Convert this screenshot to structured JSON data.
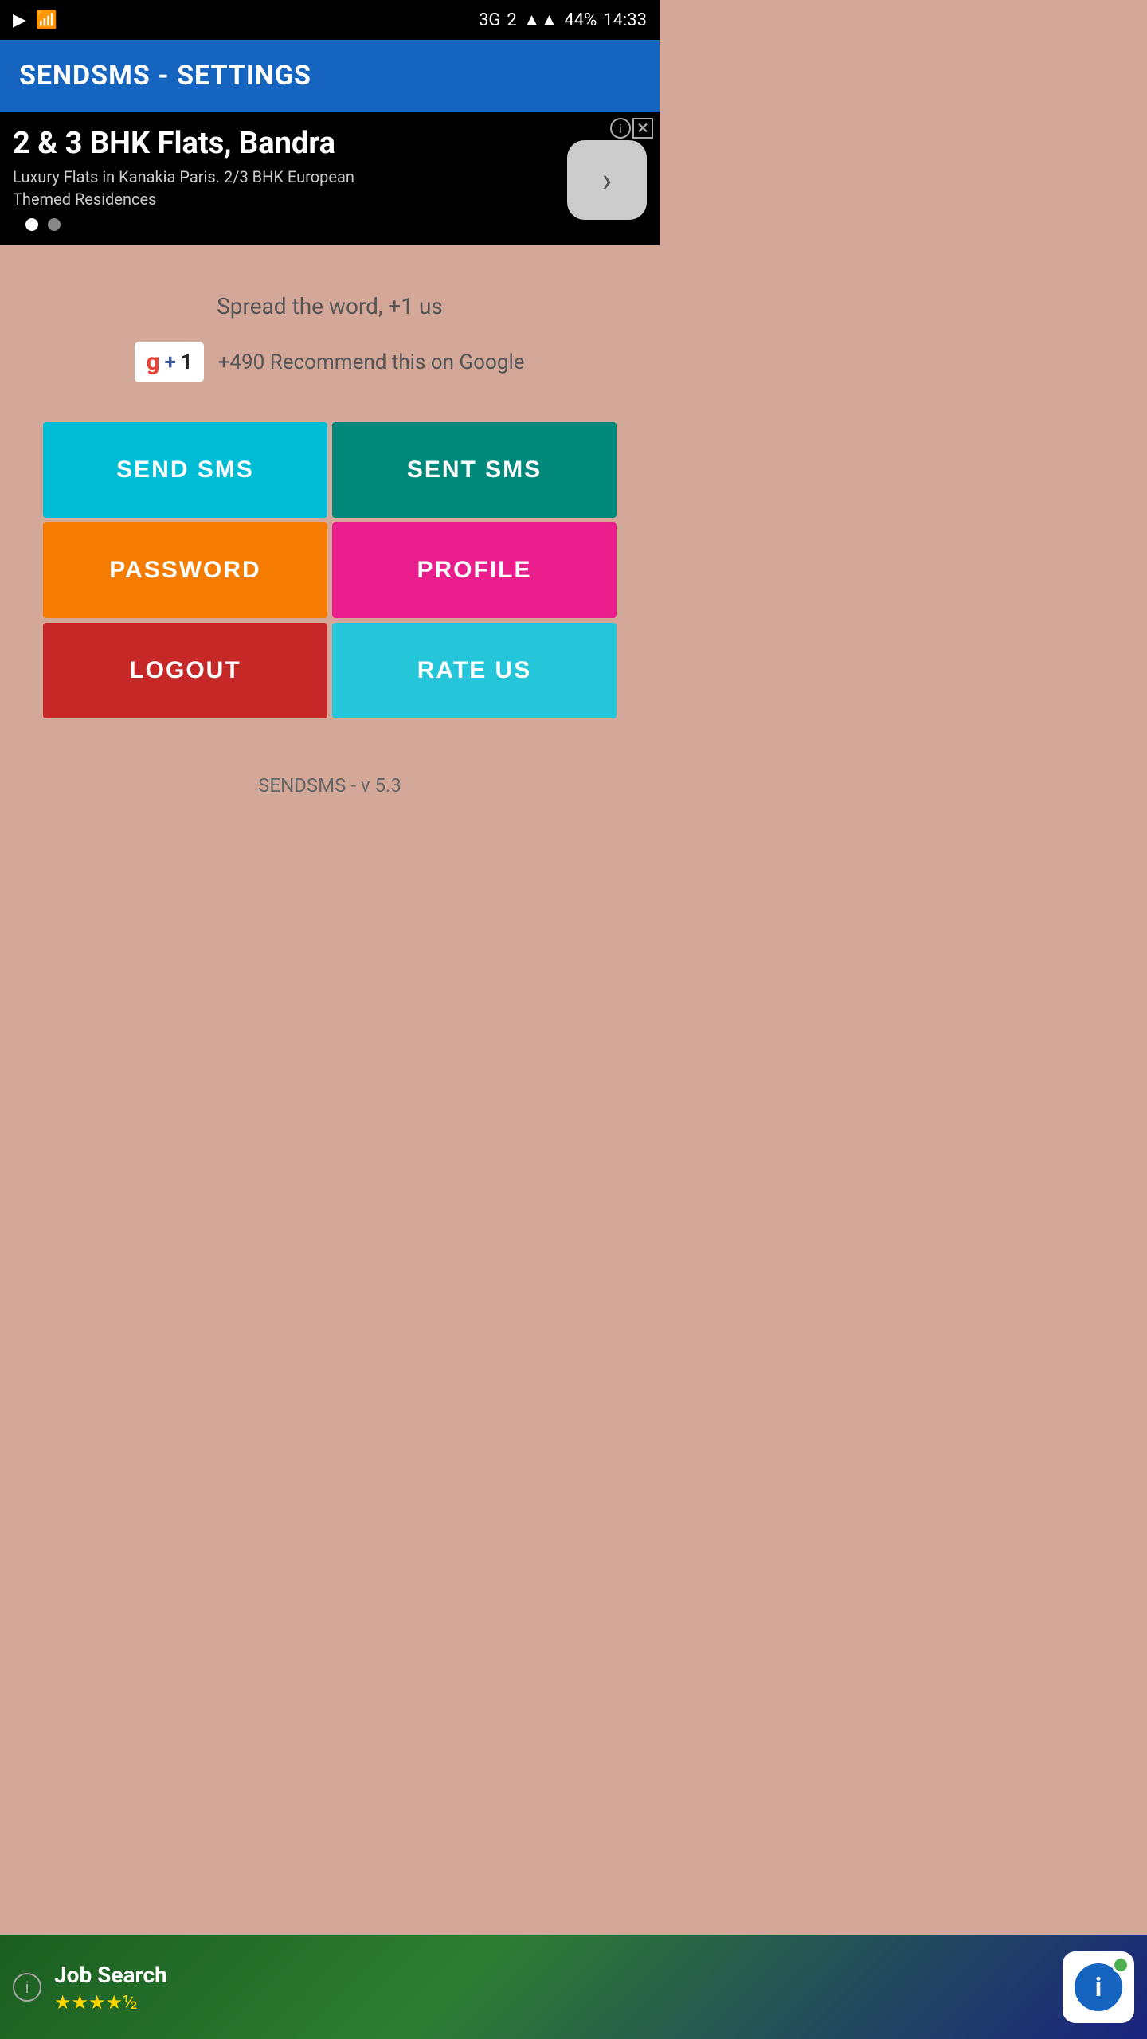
{
  "statusBar": {
    "time": "14:33",
    "battery": "44%",
    "network": "3G",
    "sim": "2"
  },
  "appBar": {
    "title": "SENDSMS - SETTINGS"
  },
  "ad": {
    "title": "2 & 3 BHK Flats, Bandra",
    "subtitle": "Luxury Flats in Kanakia Paris. 2/3 BHK European Themed Residences",
    "arrowLabel": "›",
    "closeBtnInfo": "ⓘ",
    "closeBtnX": "✕",
    "dot1Active": true,
    "dot2Active": false
  },
  "main": {
    "spreadText": "Spread the word, +1 us",
    "gplusCount": "+490",
    "gplusLabel": "Recommend this on Google",
    "buttons": {
      "sendSms": "SEND SMS",
      "sentSms": "SENT SMS",
      "password": "PASSWORD",
      "profile": "PROFILE",
      "logout": "LOGOUT",
      "rateUs": "RATE US"
    },
    "versionText": "SENDSMS - v 5.3"
  },
  "bottomAd": {
    "title": "Job Search",
    "stars": "★★★★½",
    "infoIcon": "ⓘ"
  }
}
